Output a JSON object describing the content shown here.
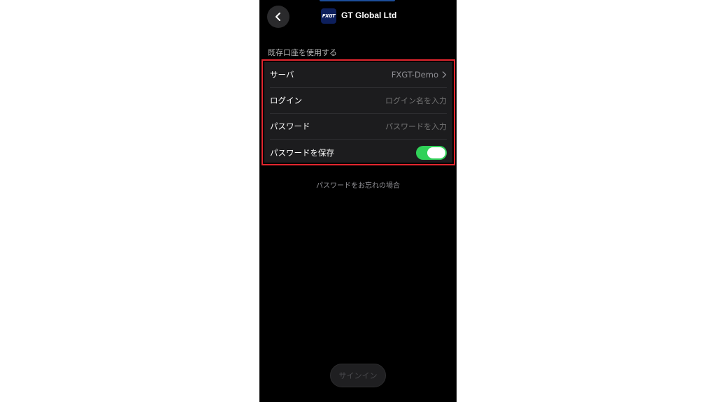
{
  "header": {
    "back_icon": "chevron-left-icon",
    "logo_text": "FXGT",
    "broker_name": "GT Global Ltd"
  },
  "section": {
    "label": "既存口座を使用する"
  },
  "form": {
    "server_label": "サーバ",
    "server_value": "FXGT-Demo",
    "login_label": "ログイン",
    "login_placeholder": "ログイン名を入力",
    "password_label": "パスワード",
    "password_placeholder": "パスワードを入力",
    "save_password_label": "パスワードを保存",
    "save_password_on": true,
    "highlight_color": "#e2262e",
    "toggle_color": "#30d158"
  },
  "links": {
    "forgot_password": "パスワードをお忘れの場合"
  },
  "actions": {
    "sign_in_label": "サインイン"
  }
}
